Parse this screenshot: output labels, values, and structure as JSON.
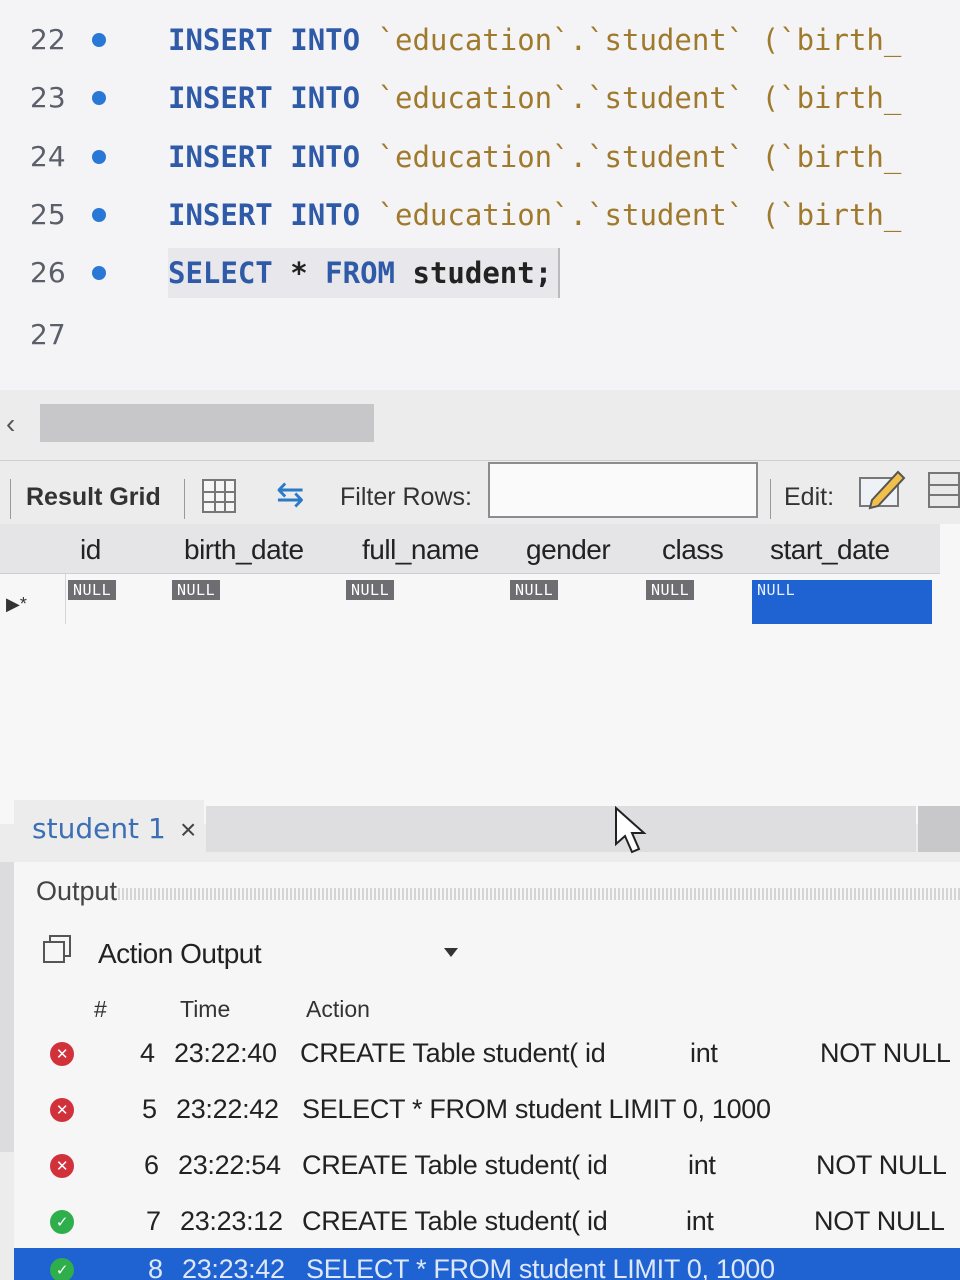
{
  "editor": {
    "lines": [
      {
        "num": "22",
        "kw1": "INSERT",
        "kw2": "INTO",
        "rest": "`education`.`student` (`birth_"
      },
      {
        "num": "23",
        "kw1": "INSERT",
        "kw2": "INTO",
        "rest": "`education`.`student` (`birth_"
      },
      {
        "num": "24",
        "kw1": "INSERT",
        "kw2": "INTO",
        "rest": "`education`.`student` (`birth_"
      },
      {
        "num": "25",
        "kw1": "INSERT",
        "kw2": "INTO",
        "rest": "`education`.`student` (`birth_"
      },
      {
        "num": "26",
        "kw1": "SELECT",
        "star": "*",
        "kw2": "FROM",
        "rest": "student;"
      },
      {
        "num": "27"
      }
    ]
  },
  "toolbar": {
    "result_grid_label": "Result Grid",
    "filter_label": "Filter Rows:",
    "filter_value": "",
    "edit_label": "Edit:"
  },
  "grid": {
    "columns": [
      "id",
      "birth_date",
      "full_name",
      "gender",
      "class",
      "start_date"
    ],
    "row_marker": "▶*",
    "null_text": "NULL",
    "selected_column": "start_date"
  },
  "result_tabs": {
    "tab_label": "student 1",
    "close_glyph": "×"
  },
  "output": {
    "title": "Output",
    "type_label": "Action Output",
    "headers": {
      "num": "#",
      "time": "Time",
      "action": "Action"
    },
    "rows": [
      {
        "status": "error",
        "num": "4",
        "time": "23:22:40",
        "action": "CREATE Table student( id",
        "type": "int",
        "extra": "NOT NULL"
      },
      {
        "status": "error",
        "num": "5",
        "time": "23:22:42",
        "action": "SELECT * FROM student LIMIT 0, 1000",
        "type": "",
        "extra": ""
      },
      {
        "status": "error",
        "num": "6",
        "time": "23:22:54",
        "action": "CREATE Table student( id",
        "type": "int",
        "extra": "NOT NULL"
      },
      {
        "status": "ok",
        "num": "7",
        "time": "23:23:12",
        "action": "CREATE Table student( id",
        "type": "int",
        "extra": "NOT NULL"
      },
      {
        "status": "ok",
        "num": "8",
        "time": "23:23:42",
        "action": "SELECT * FROM student LIMIT 0, 1000",
        "type": "",
        "extra": ""
      }
    ]
  },
  "colors": {
    "keyword": "#2f5aa8",
    "string": "#a07a2c",
    "breakpoint_dot": "#2a78d6",
    "selection": "#1f62d1",
    "error": "#d0313a",
    "success": "#2fae4c"
  },
  "icons": {
    "grid_view": "grid-view-icon",
    "refresh": "refresh-icon",
    "edit": "edit-pencil-icon",
    "table": "table-icon",
    "copy": "copy-icon",
    "dropdown": "chevron-down-icon",
    "error": "error-x-icon",
    "success": "check-icon"
  }
}
